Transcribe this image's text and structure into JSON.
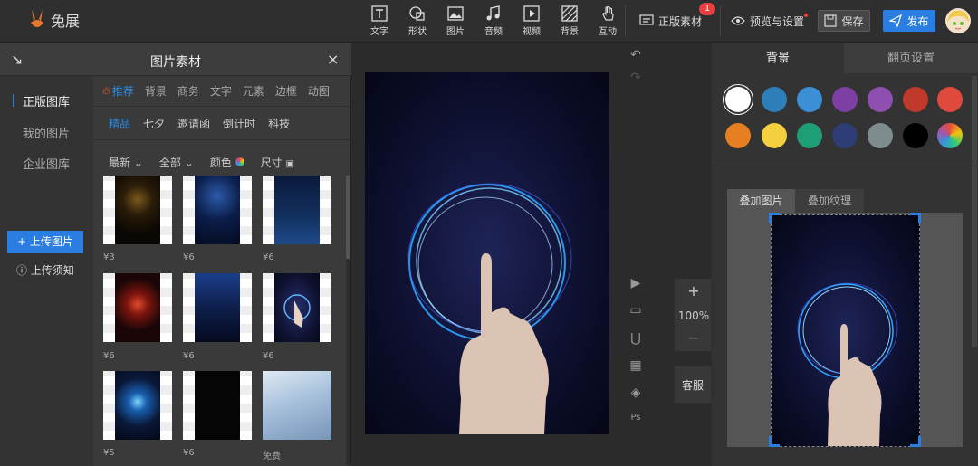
{
  "app": {
    "name": "兔展"
  },
  "toolbar": {
    "tools": [
      {
        "label": "文字",
        "icon": "text-icon"
      },
      {
        "label": "形状",
        "icon": "shape-icon"
      },
      {
        "label": "图片",
        "icon": "image-icon"
      },
      {
        "label": "音频",
        "icon": "music-icon"
      },
      {
        "label": "视频",
        "icon": "video-icon"
      },
      {
        "label": "背景",
        "icon": "background-icon"
      },
      {
        "label": "互动",
        "icon": "hand-icon"
      }
    ],
    "licensed": {
      "label": "正版素材",
      "badge": "1"
    },
    "preview": "预览与设置",
    "save": "保存",
    "publish": "发布"
  },
  "left_panel": {
    "title": "图片素材",
    "libraries": [
      "正版图库",
      "我的图片",
      "企业图库"
    ],
    "upload": "+ 上传图片",
    "upload_note": "上传须知",
    "categories": [
      "推荐",
      "背景",
      "商务",
      "文字",
      "元素",
      "边框",
      "动图"
    ],
    "subcategories": [
      "精品",
      "七夕",
      "邀请函",
      "倒计时",
      "科技"
    ],
    "filters": [
      "最新",
      "全部",
      "颜色",
      "尺寸"
    ],
    "items": [
      {
        "price": "¥3",
        "theme": "gold-particles"
      },
      {
        "price": "¥6",
        "theme": "blue-lights"
      },
      {
        "price": "¥6",
        "theme": "blue-city"
      },
      {
        "price": "¥6",
        "theme": "red-burst"
      },
      {
        "price": "¥6",
        "theme": "blue-rays"
      },
      {
        "price": "¥6",
        "theme": "ring-hand"
      },
      {
        "price": "¥5",
        "theme": "blue-sparkle"
      },
      {
        "price": "¥6",
        "theme": "dark"
      },
      {
        "price": "免费",
        "theme": "office"
      }
    ]
  },
  "canvas": {
    "zoom": "100%",
    "service": "客服"
  },
  "right_panel": {
    "tabs": [
      "背景",
      "翻页设置"
    ],
    "colors": [
      "#ffffff",
      "#2c7fb8",
      "#3a8fd6",
      "#7d3fa3",
      "#8e4fb0",
      "#c0392b",
      "#e04a3c",
      "#e67e22",
      "#f4d03f",
      "#1e9e76",
      "#2c3e75",
      "#7f8c8d",
      "#000000"
    ],
    "overlay_tabs": [
      "叠加图片",
      "叠加纹理"
    ]
  }
}
